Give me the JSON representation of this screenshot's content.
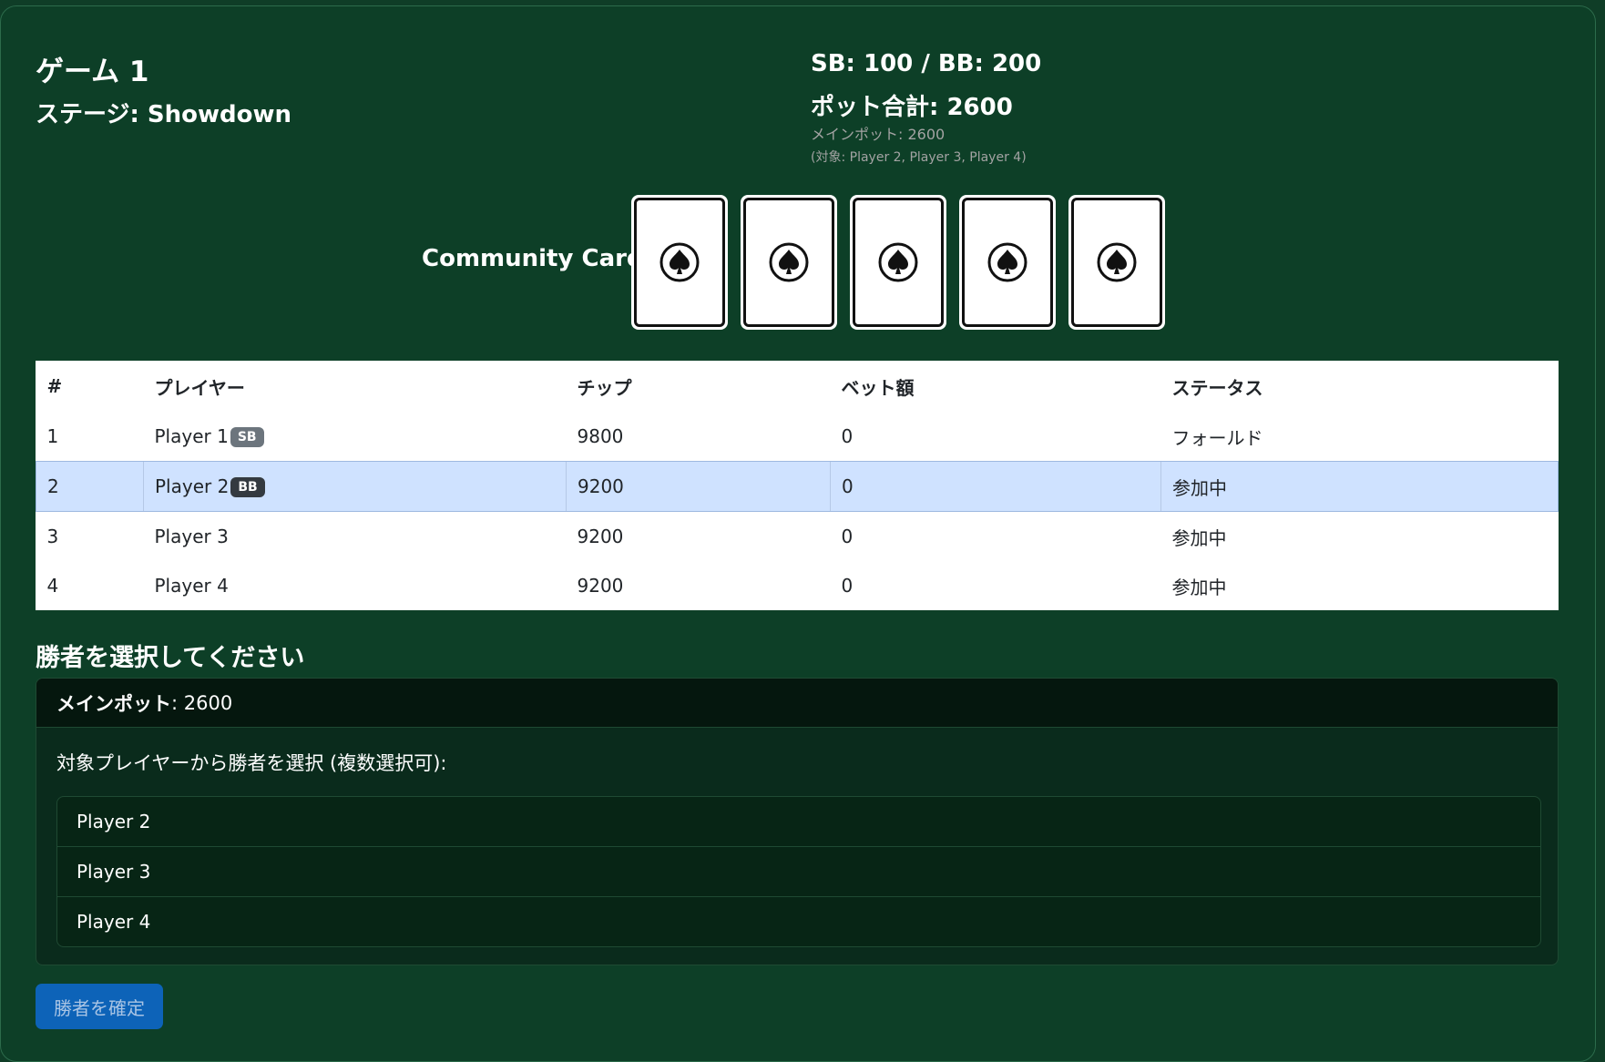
{
  "header": {
    "game_title": "ゲーム 1",
    "stage": "ステージ: Showdown",
    "blinds": "SB: 100 / BB: 200",
    "pot_total": "ポット合計: 2600",
    "main_pot": "メインポット: 2600",
    "pot_targets": "(対象: Player 2, Player 3, Player 4)"
  },
  "community": {
    "label": "Community Cards:",
    "cards": [
      {
        "suit": "spade-icon"
      },
      {
        "suit": "spade-icon"
      },
      {
        "suit": "spade-icon"
      },
      {
        "suit": "spade-icon"
      },
      {
        "suit": "spade-icon"
      }
    ]
  },
  "table": {
    "headers": [
      "#",
      "プレイヤー",
      "チップ",
      "ベット額",
      "ステータス"
    ],
    "rows": [
      {
        "num": "1",
        "player": "Player 1",
        "badge": "SB",
        "chips": "9800",
        "bet": "0",
        "status": "フォールド"
      },
      {
        "num": "2",
        "player": "Player 2",
        "badge": "BB",
        "chips": "9200",
        "bet": "0",
        "status": "参加中"
      },
      {
        "num": "3",
        "player": "Player 3",
        "badge": "",
        "chips": "9200",
        "bet": "0",
        "status": "参加中"
      },
      {
        "num": "4",
        "player": "Player 4",
        "badge": "",
        "chips": "9200",
        "bet": "0",
        "status": "参加中"
      }
    ]
  },
  "winner": {
    "heading": "勝者を選択してください",
    "pot_label": "メインポット",
    "pot_value": ": 2600",
    "instruction": "対象プレイヤーから勝者を選択 (複数選択可):",
    "options": [
      "Player 2",
      "Player 3",
      "Player 4"
    ],
    "confirm_label": "勝者を確定"
  },
  "colors": {
    "background": "#0d3f27",
    "highlight_row": "#cfe2ff",
    "primary_button": "#0d63b8"
  }
}
